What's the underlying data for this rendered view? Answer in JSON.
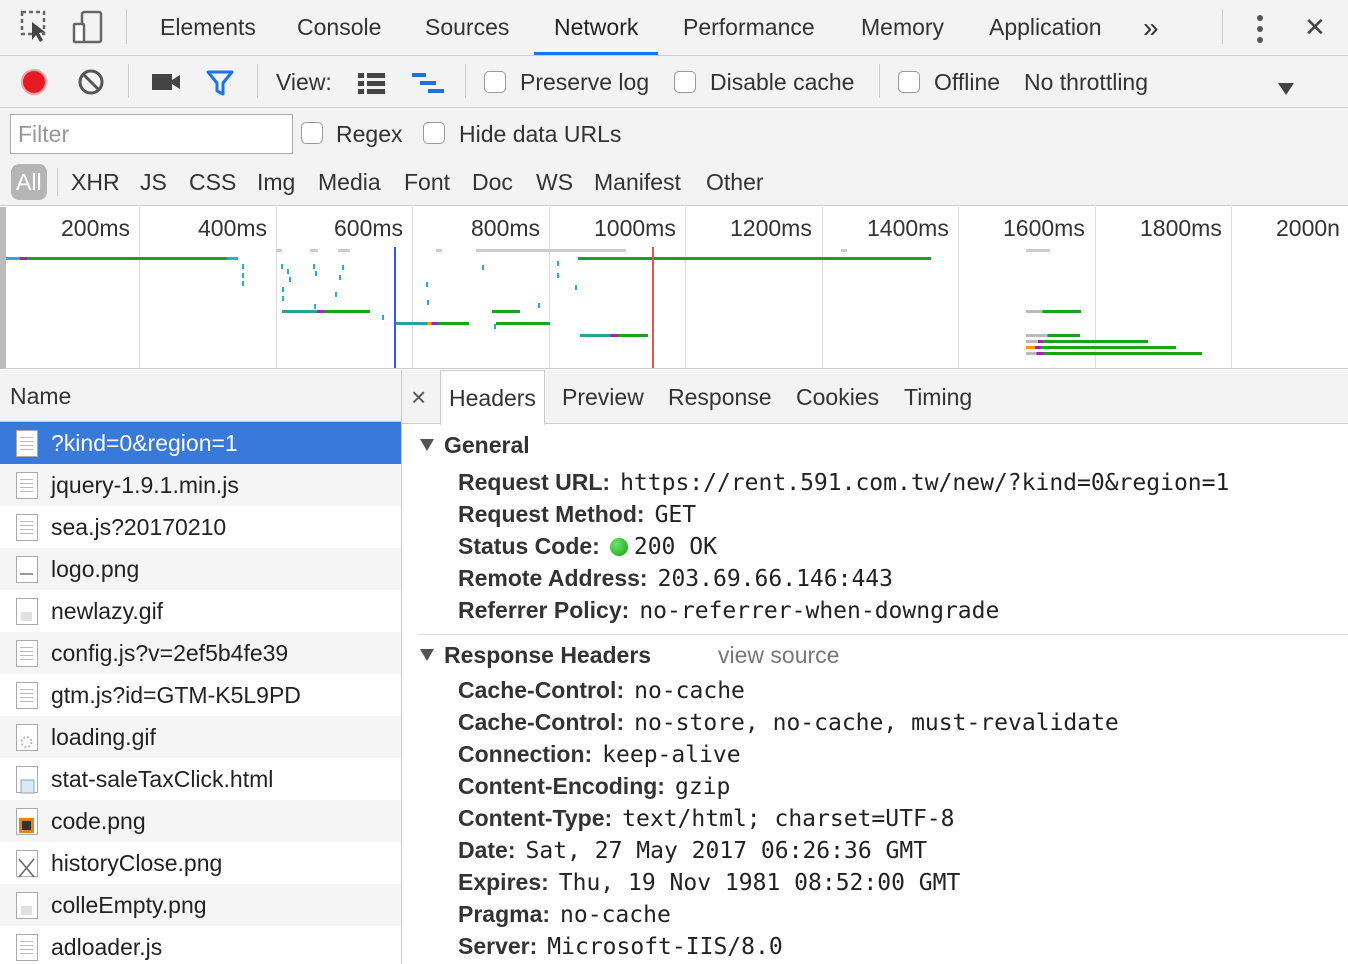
{
  "tabs": {
    "items": [
      "Elements",
      "Console",
      "Sources",
      "Network",
      "Performance",
      "Memory",
      "Application"
    ],
    "active": "Network",
    "more_label": "»",
    "close_label": "✕"
  },
  "toolbar": {
    "view_label": "View:",
    "preserve_log_label": "Preserve log",
    "disable_cache_label": "Disable cache",
    "offline_label": "Offline",
    "throttling_value": "No throttling",
    "record_color": "#e51c23",
    "filter_color": "#1a73e8"
  },
  "filter": {
    "placeholder": "Filter",
    "regex_label": "Regex",
    "hide_data_urls_label": "Hide data URLs",
    "types": [
      "All",
      "XHR",
      "JS",
      "CSS",
      "Img",
      "Media",
      "Font",
      "Doc",
      "WS",
      "Manifest",
      "Other"
    ],
    "active_type": "All"
  },
  "overview": {
    "ticks": [
      "200ms",
      "400ms",
      "600ms",
      "800ms",
      "1000ms",
      "1200ms",
      "1400ms",
      "1600ms",
      "1800ms",
      "2000n"
    ]
  },
  "requests": {
    "header": "Name",
    "items": [
      {
        "name": "?kind=0&region=1",
        "icon": "document-icon"
      },
      {
        "name": "jquery-1.9.1.min.js",
        "icon": "script-icon"
      },
      {
        "name": "sea.js?20170210",
        "icon": "script-icon"
      },
      {
        "name": "logo.png",
        "icon": "image-icon"
      },
      {
        "name": "newlazy.gif",
        "icon": "image-icon"
      },
      {
        "name": "config.js?v=2ef5b4fe39",
        "icon": "script-icon"
      },
      {
        "name": "gtm.js?id=GTM-K5L9PD",
        "icon": "script-icon"
      },
      {
        "name": "loading.gif",
        "icon": "spinner-icon"
      },
      {
        "name": "stat-saleTaxClick.html",
        "icon": "html-icon"
      },
      {
        "name": "code.png",
        "icon": "image-icon"
      },
      {
        "name": "historyClose.png",
        "icon": "close-image-icon"
      },
      {
        "name": "colleEmpty.png",
        "icon": "image-icon"
      },
      {
        "name": "adloader.js",
        "icon": "script-icon"
      }
    ],
    "selected_index": 0
  },
  "details": {
    "close_label": "×",
    "tabs": [
      "Headers",
      "Preview",
      "Response",
      "Cookies",
      "Timing"
    ],
    "active_tab": "Headers",
    "general": {
      "title": "General",
      "rows": [
        {
          "key": "Request URL:",
          "value": "https://rent.591.com.tw/new/?kind=0&region=1"
        },
        {
          "key": "Request Method:",
          "value": "GET"
        },
        {
          "key": "Status Code:",
          "value": "200 OK"
        },
        {
          "key": "Remote Address:",
          "value": "203.69.66.146:443"
        },
        {
          "key": "Referrer Policy:",
          "value": "no-referrer-when-downgrade"
        }
      ]
    },
    "response_headers": {
      "title": "Response Headers",
      "view_source_label": "view source",
      "rows": [
        {
          "key": "Cache-Control:",
          "value": "no-cache"
        },
        {
          "key": "Cache-Control:",
          "value": "no-store, no-cache, must-revalidate"
        },
        {
          "key": "Connection:",
          "value": "keep-alive"
        },
        {
          "key": "Content-Encoding:",
          "value": "gzip"
        },
        {
          "key": "Content-Type:",
          "value": "text/html; charset=UTF-8"
        },
        {
          "key": "Date:",
          "value": "Sat, 27 May 2017 06:26:36 GMT"
        },
        {
          "key": "Expires:",
          "value": "Thu, 19 Nov 1981 08:52:00 GMT"
        },
        {
          "key": "Pragma:",
          "value": "no-cache"
        },
        {
          "key": "Server:",
          "value": "Microsoft-IIS/8.0"
        }
      ]
    }
  }
}
